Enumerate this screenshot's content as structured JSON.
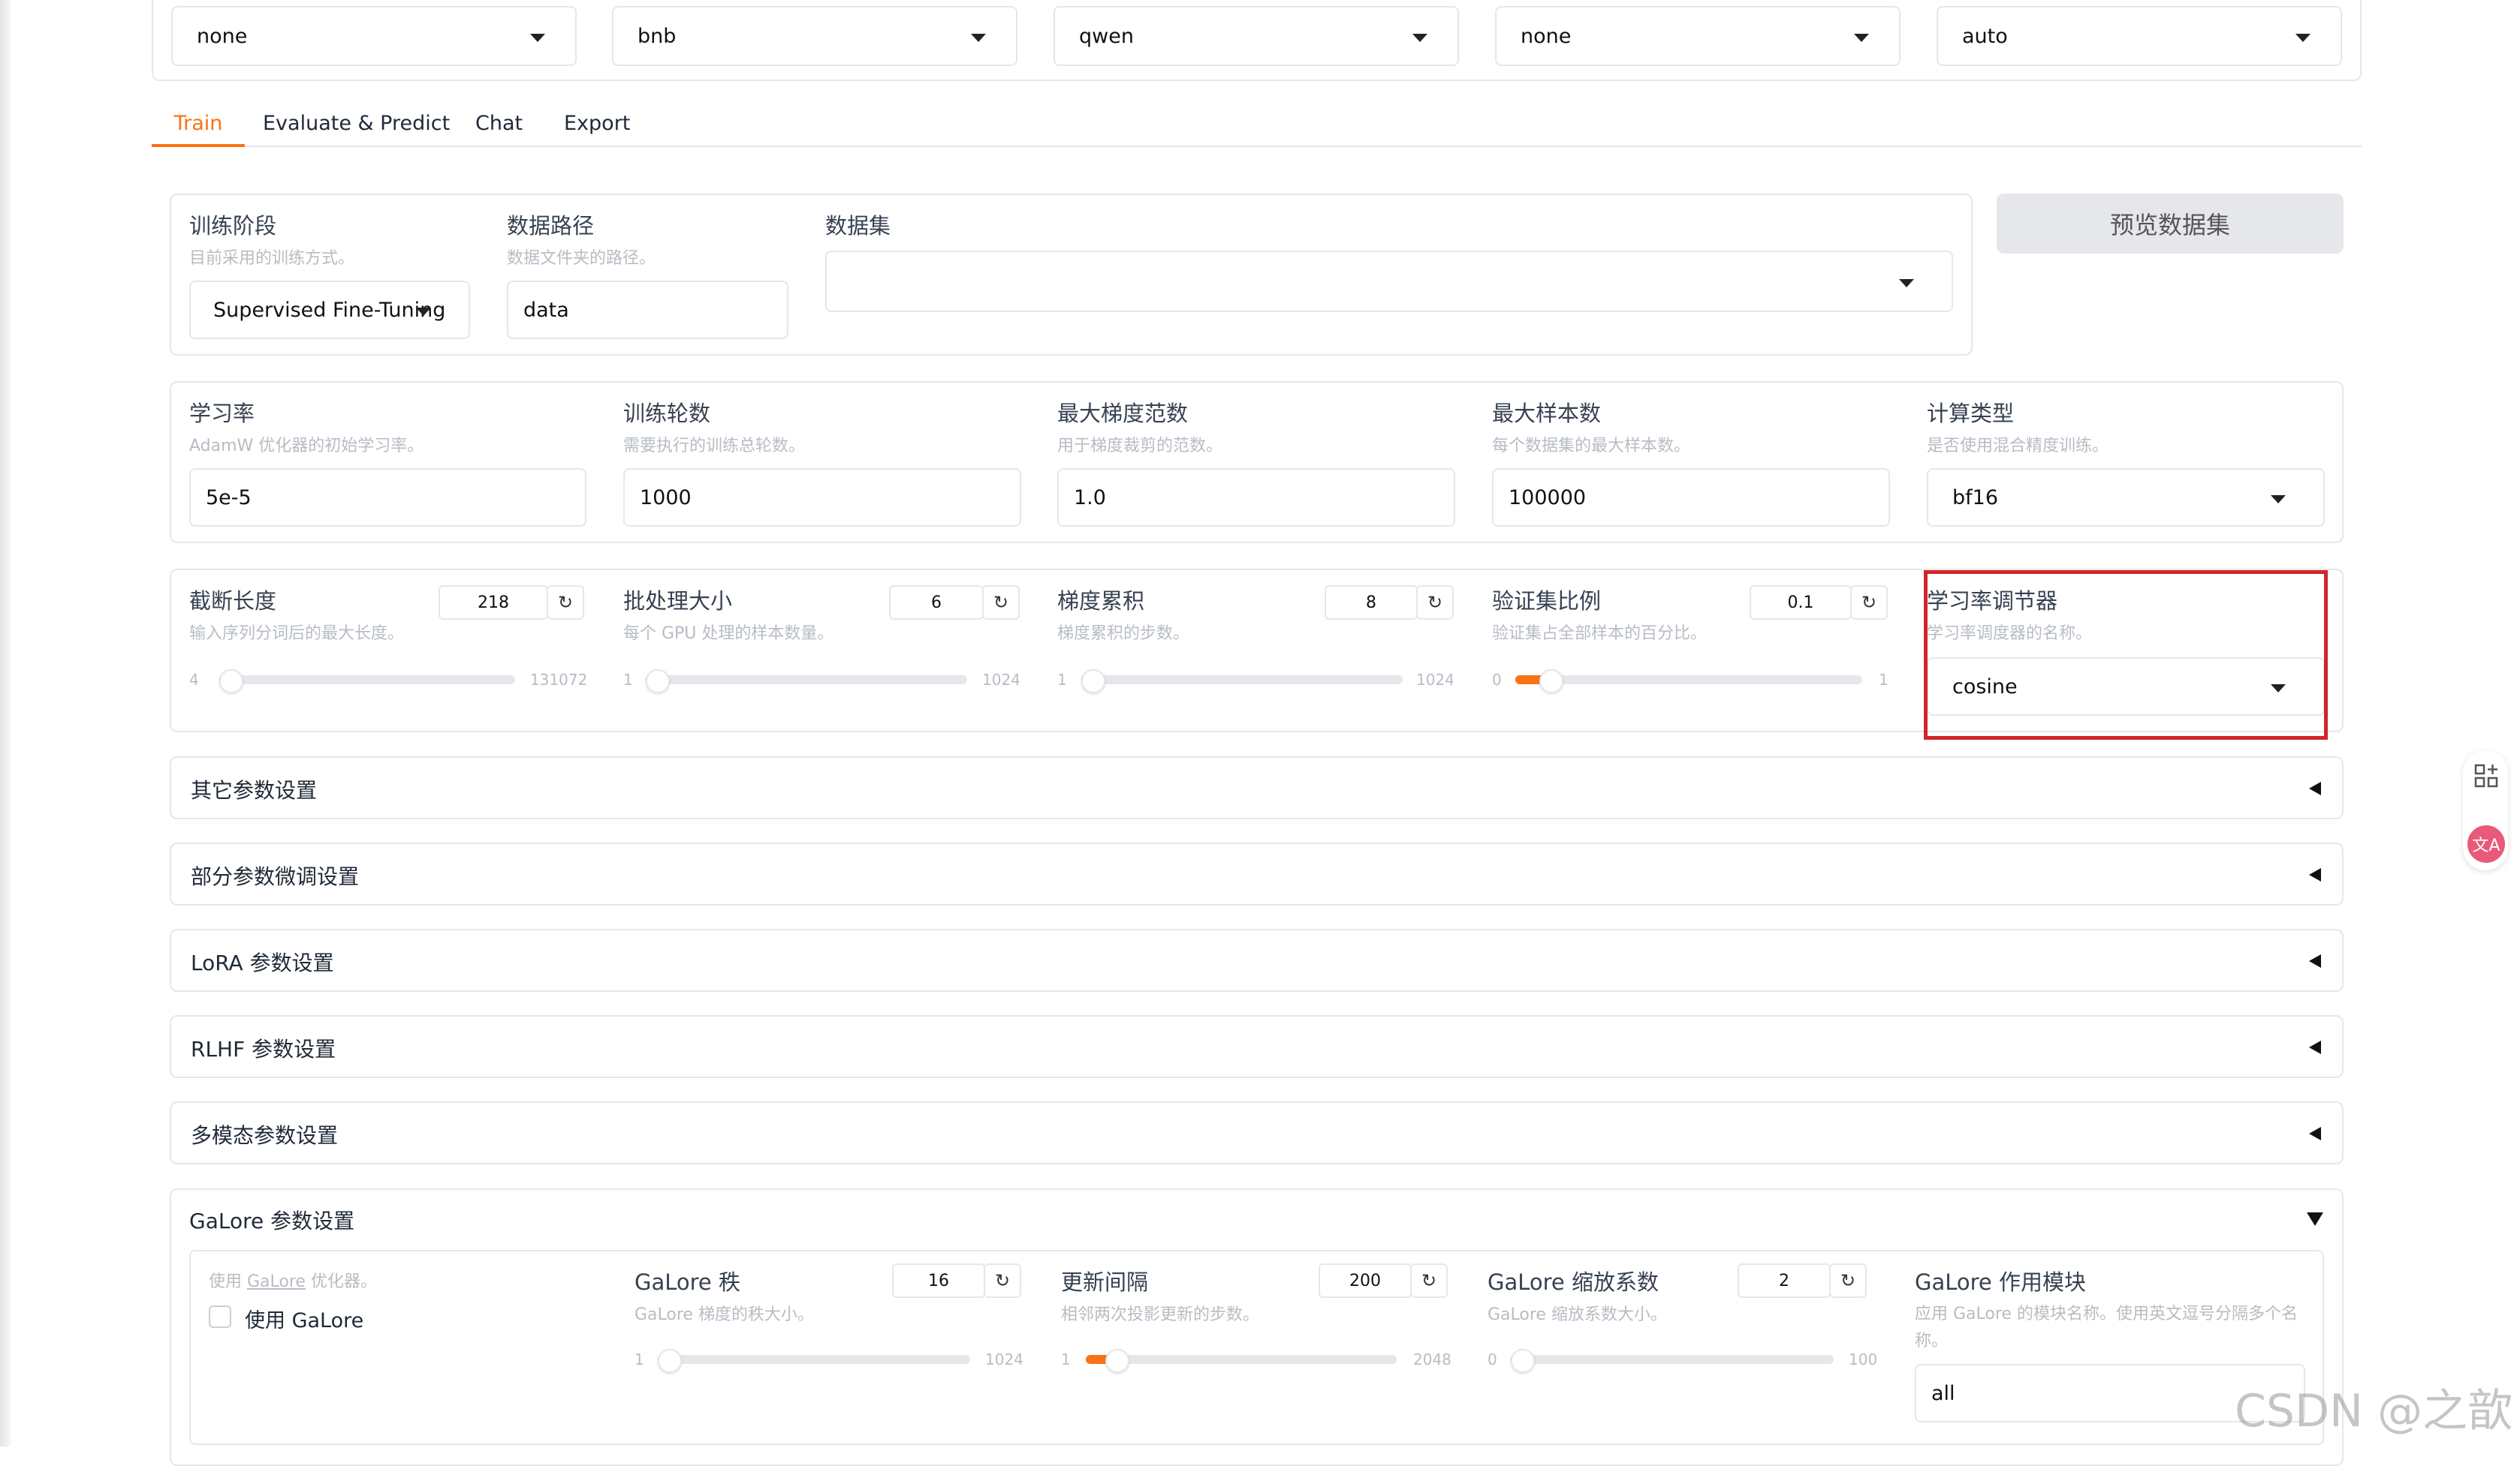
{
  "top_selects": [
    "none",
    "bnb",
    "qwen",
    "none",
    "auto"
  ],
  "tabs": [
    {
      "label": "Train",
      "active": true
    },
    {
      "label": "Evaluate & Predict",
      "active": false
    },
    {
      "label": "Chat",
      "active": false
    },
    {
      "label": "Export",
      "active": false
    }
  ],
  "stage": {
    "label": "训练阶段",
    "info": "目前采用的训练方式。",
    "value": "Supervised Fine-Tuning"
  },
  "data_dir": {
    "label": "数据路径",
    "info": "数据文件夹的路径。",
    "value": "data"
  },
  "dataset": {
    "label": "数据集",
    "value": ""
  },
  "preview_button": "预览数据集",
  "row2": {
    "learning_rate": {
      "label": "学习率",
      "info": "AdamW 优化器的初始学习率。",
      "value": "5e-5"
    },
    "epochs": {
      "label": "训练轮数",
      "info": "需要执行的训练总轮数。",
      "value": "1000"
    },
    "max_grad_norm": {
      "label": "最大梯度范数",
      "info": "用于梯度裁剪的范数。",
      "value": "1.0"
    },
    "max_samples": {
      "label": "最大样本数",
      "info": "每个数据集的最大样本数。",
      "value": "100000"
    },
    "compute_type": {
      "label": "计算类型",
      "info": "是否使用混合精度训练。",
      "value": "bf16"
    }
  },
  "sliders": [
    {
      "label": "截断长度",
      "info": "输入序列分词后的最大长度。",
      "value": "218",
      "min": "4",
      "max": "131072",
      "level": 0.002
    },
    {
      "label": "批处理大小",
      "info": "每个 GPU 处理的样本数量。",
      "value": "6",
      "min": "1",
      "max": "1024",
      "level": 0.005
    },
    {
      "label": "梯度累积",
      "info": "梯度累积的步数。",
      "value": "8",
      "min": "1",
      "max": "1024",
      "level": 0.007
    },
    {
      "label": "验证集比例",
      "info": "验证集占全部样本的百分比。",
      "value": "0.1",
      "min": "0",
      "max": "1",
      "level": 0.1
    }
  ],
  "scheduler": {
    "label": "学习率调节器",
    "info": "学习率调度器的名称。",
    "value": "cosine"
  },
  "accordions": [
    "其它参数设置",
    "部分参数微调设置",
    "LoRA 参数设置",
    "RLHF 参数设置",
    "多模态参数设置"
  ],
  "galore": {
    "title": "GaLore 参数设置",
    "use_info_prefix": "使用 ",
    "use_info_link": "GaLore",
    "use_info_suffix": " 优化器。",
    "use_label": "使用 GaLore",
    "sliders": [
      {
        "label": "GaLore 秩",
        "info": "GaLore 梯度的秩大小。",
        "value": "16",
        "min": "1",
        "max": "1024",
        "level": 0.015
      },
      {
        "label": "更新间隔",
        "info": "相邻两次投影更新的步数。",
        "value": "200",
        "min": "1",
        "max": "2048",
        "level": 0.097
      },
      {
        "label": "GaLore 缩放系数",
        "info": "GaLore 缩放系数大小。",
        "value": "2",
        "min": "0",
        "max": "100",
        "level": 0.02
      }
    ],
    "target": {
      "label": "GaLore 作用模块",
      "info": "应用 GaLore 的模块名称。使用英文逗号分隔多个名称。",
      "value": "all"
    }
  },
  "watermark": "CSDN @之歆",
  "colors": {
    "accent": "#f97316",
    "highlight": "#d0262b",
    "translate": "#e8597a"
  }
}
